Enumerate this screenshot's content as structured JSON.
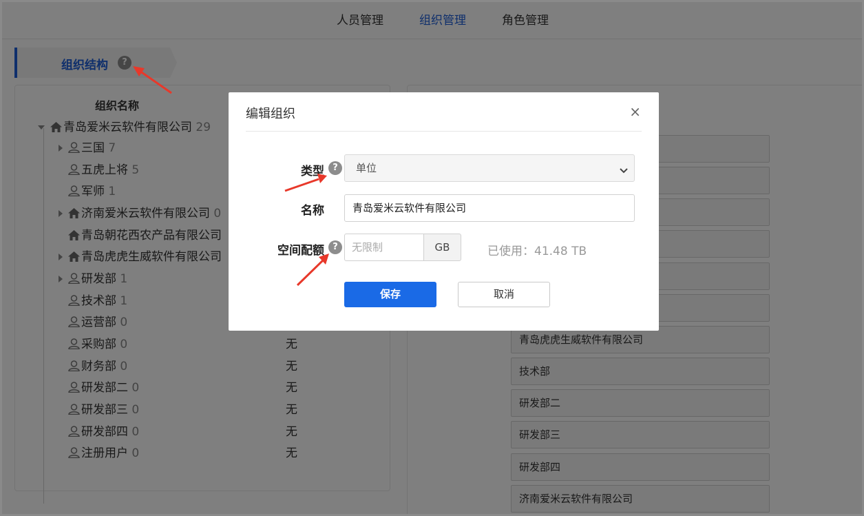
{
  "topnav": {
    "tabs": [
      {
        "label": "人员管理",
        "active": false
      },
      {
        "label": "组织管理",
        "active": true
      },
      {
        "label": "角色管理",
        "active": false
      }
    ]
  },
  "section": {
    "title": "组织结构",
    "help": "?"
  },
  "tree": {
    "column_header": "组织名称",
    "root": {
      "name": "青岛爱米云软件有限公司",
      "count": "29"
    },
    "rows": [
      {
        "name": "三国",
        "count": "7",
        "icon": "user-icon",
        "expandable": true,
        "quota": ""
      },
      {
        "name": "五虎上将",
        "count": "5",
        "icon": "user-icon",
        "expandable": false,
        "quota": ""
      },
      {
        "name": "军师",
        "count": "1",
        "icon": "user-icon",
        "expandable": false,
        "quota": ""
      },
      {
        "name": "济南爱米云软件有限公司",
        "count": "0",
        "icon": "home-icon",
        "expandable": true,
        "quota": ""
      },
      {
        "name": "青岛朝花西农产品有限公司",
        "count": "",
        "icon": "home-icon",
        "expandable": false,
        "quota": ""
      },
      {
        "name": "青岛虎虎生威软件有限公司",
        "count": "",
        "icon": "home-icon",
        "expandable": true,
        "quota": ""
      },
      {
        "name": "研发部",
        "count": "1",
        "icon": "user-icon",
        "expandable": true,
        "quota": ""
      },
      {
        "name": "技术部",
        "count": "1",
        "icon": "user-icon",
        "expandable": false,
        "quota": ""
      },
      {
        "name": "运营部",
        "count": "0",
        "icon": "user-icon",
        "expandable": false,
        "quota": ""
      },
      {
        "name": "采购部",
        "count": "0",
        "icon": "user-icon",
        "expandable": false,
        "quota": "无"
      },
      {
        "name": "财务部",
        "count": "0",
        "icon": "user-icon",
        "expandable": false,
        "quota": "无"
      },
      {
        "name": "研发部二",
        "count": "0",
        "icon": "user-icon",
        "expandable": false,
        "quota": "无"
      },
      {
        "name": "研发部三",
        "count": "0",
        "icon": "user-icon",
        "expandable": false,
        "quota": "无"
      },
      {
        "name": "研发部四",
        "count": "0",
        "icon": "user-icon",
        "expandable": false,
        "quota": "无"
      },
      {
        "name": "注册用户",
        "count": "0",
        "icon": "user-icon",
        "expandable": false,
        "quota": "无"
      }
    ]
  },
  "right_list": {
    "items": [
      "",
      "",
      "",
      "",
      "",
      "",
      "青岛虎虎生威软件有限公司",
      "技术部",
      "研发部二",
      "研发部三",
      "研发部四",
      "济南爱米云软件有限公司"
    ]
  },
  "modal": {
    "title": "编辑组织",
    "close": "×",
    "type_label": "类型",
    "type_value": "单位",
    "name_label": "名称",
    "name_value": "青岛爱米云软件有限公司",
    "quota_label": "空间配额",
    "quota_placeholder": "无限制",
    "quota_unit": "GB",
    "used_text": "已使用：41.48 TB",
    "save_label": "保存",
    "cancel_label": "取消",
    "help": "?"
  },
  "colors": {
    "accent": "#1e5fd8",
    "primary_button": "#1a6ae6",
    "annotation_arrow": "#e8382a"
  }
}
